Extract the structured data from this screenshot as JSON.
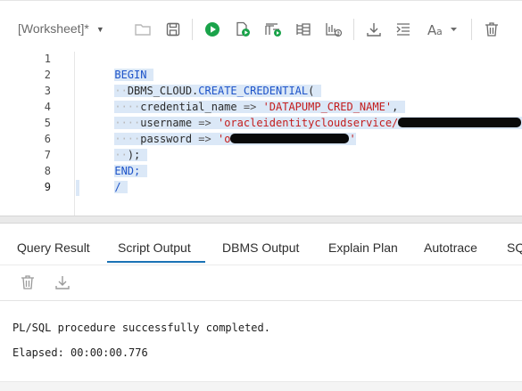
{
  "toolbar": {
    "worksheet_label": "[Worksheet]*",
    "icons": [
      "open-folder-icon",
      "save-icon",
      "run-statement-icon",
      "run-script-icon",
      "explain-plan-icon",
      "autotrace-icon",
      "sql-history-icon",
      "download-icon",
      "format-icon",
      "font-size-icon",
      "clear-icon"
    ],
    "run_color": "#1aa34a"
  },
  "editor": {
    "line_numbers": [
      "1",
      "2",
      "3",
      "4",
      "5",
      "6",
      "7",
      "8",
      "9"
    ],
    "lines": [
      {
        "kw1": "BEGIN"
      },
      {
        "obj": "DBMS_CLOUD.",
        "fn": "CREATE_CREDENTIAL",
        "paren": "("
      },
      {
        "param": "credential_name",
        "arrow": "=>",
        "value": "'DATAPUMP_CRED_NAME'",
        "comma": ","
      },
      {
        "param": "username",
        "arrow": "=>",
        "value": "'oracleidentitycloudservice/",
        "value_tail": "'",
        "comma": ","
      },
      {
        "param": "password",
        "arrow": "=>",
        "value": "'o",
        "value_tail": "'"
      },
      {
        "close": ");"
      },
      {
        "kw1": "END;"
      },
      {
        "kw1": "/"
      },
      {
        "kw1": ""
      }
    ],
    "colors": {
      "keyword": "#1d53c9",
      "string": "#c41d1d",
      "selection": "#dbe8f7"
    }
  },
  "tabs": [
    "Query Result",
    "Script Output",
    "DBMS Output",
    "Explain Plan",
    "Autotrace",
    "SQ"
  ],
  "active_tab": "Script Output",
  "output": {
    "line1": "PL/SQL procedure successfully completed.",
    "line2": "Elapsed: 00:00:00.776"
  }
}
